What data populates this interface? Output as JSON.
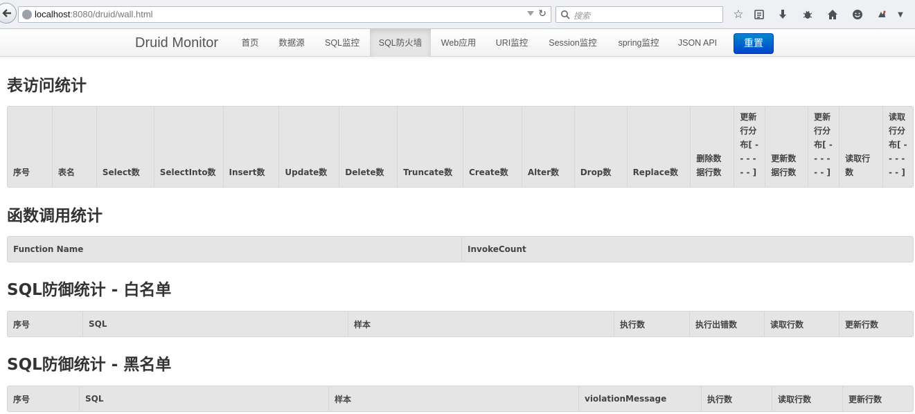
{
  "browser": {
    "url_host": "localhost",
    "url_path": ":8080/druid/wall.html",
    "search_placeholder": "搜索"
  },
  "navbar": {
    "brand": "Druid Monitor",
    "items": [
      {
        "label": "首页"
      },
      {
        "label": "数据源"
      },
      {
        "label": "SQL监控"
      },
      {
        "label": "SQL防火墙",
        "active": true
      },
      {
        "label": "Web应用"
      },
      {
        "label": "URI监控"
      },
      {
        "label": "Session监控"
      },
      {
        "label": "spring监控"
      },
      {
        "label": "JSON API"
      }
    ],
    "reset_label": "重置"
  },
  "table_stats": {
    "title": "表访问统计",
    "columns": [
      "序号",
      "表名",
      "Select数",
      "SelectInto数",
      "Insert数",
      "Update数",
      "Delete数",
      "Truncate数",
      "Create数",
      "Alter数",
      "Drop数",
      "Replace数",
      "删除数据行数",
      "更新行分布[ - - - - - - ]",
      "更新数据行数",
      "更新行分布[ - - - - - - ]",
      "读取行数",
      "读取行分布[ - - - - - - ]"
    ]
  },
  "function_stats": {
    "title": "函数调用统计",
    "columns": [
      "Function Name",
      "InvokeCount"
    ]
  },
  "whitelist": {
    "title": "SQL防御统计 - 白名单",
    "columns": [
      "序号",
      "SQL",
      "样本",
      "执行数",
      "执行出错数",
      "读取行数",
      "更新行数"
    ]
  },
  "blacklist": {
    "title": "SQL防御统计 - 黑名单",
    "columns": [
      "序号",
      "SQL",
      "样本",
      "violationMessage",
      "执行数",
      "读取行数",
      "更新行数"
    ]
  }
}
